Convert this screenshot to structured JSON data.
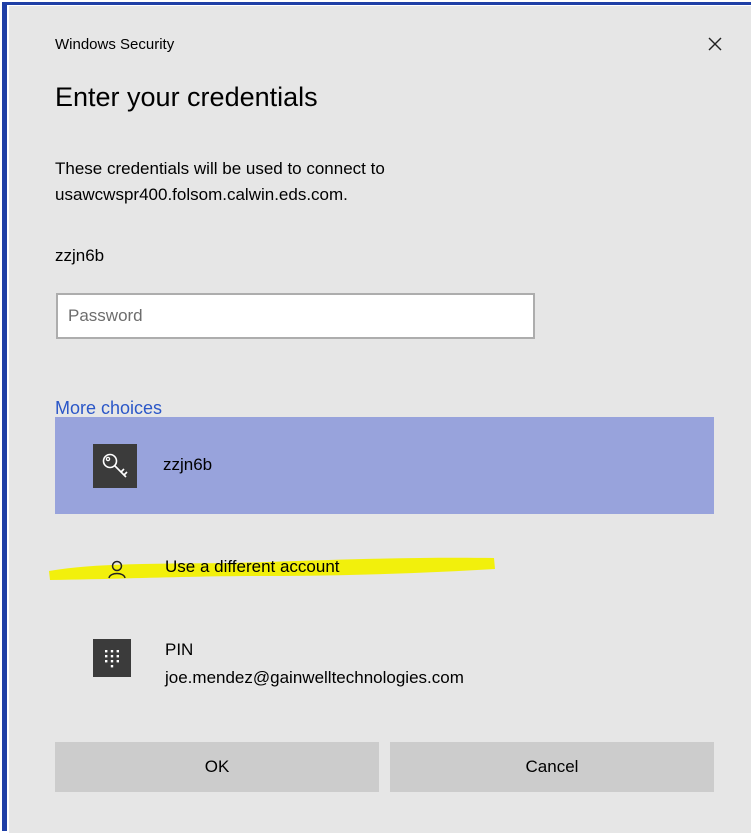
{
  "window": {
    "title": "Windows Security"
  },
  "dialog": {
    "heading": "Enter your credentials",
    "description_line1": "These credentials will be used to connect to",
    "description_line2": "usawcwspr400.folsom.calwin.eds.com.",
    "username": "zzjn6b"
  },
  "password_field": {
    "placeholder": "Password",
    "value": ""
  },
  "more_choices": {
    "label": "More choices",
    "options": [
      {
        "label": "zzjn6b",
        "icon": "key-icon",
        "selected": true
      },
      {
        "label": "Use a different account",
        "icon": "person-icon",
        "selected": false
      },
      {
        "label": "PIN",
        "sublabel": "joe.mendez@gainwelltechnologies.com",
        "icon": "keypad-icon",
        "selected": false
      }
    ]
  },
  "buttons": {
    "ok": "OK",
    "cancel": "Cancel"
  },
  "colors": {
    "dialog_bg": "#e6e6e6",
    "selected_bg": "#98a3dc",
    "link": "#2b57c8",
    "highlight": "#f2f000",
    "button_bg": "#cccccc",
    "window_frame": "#1f3fa6"
  }
}
